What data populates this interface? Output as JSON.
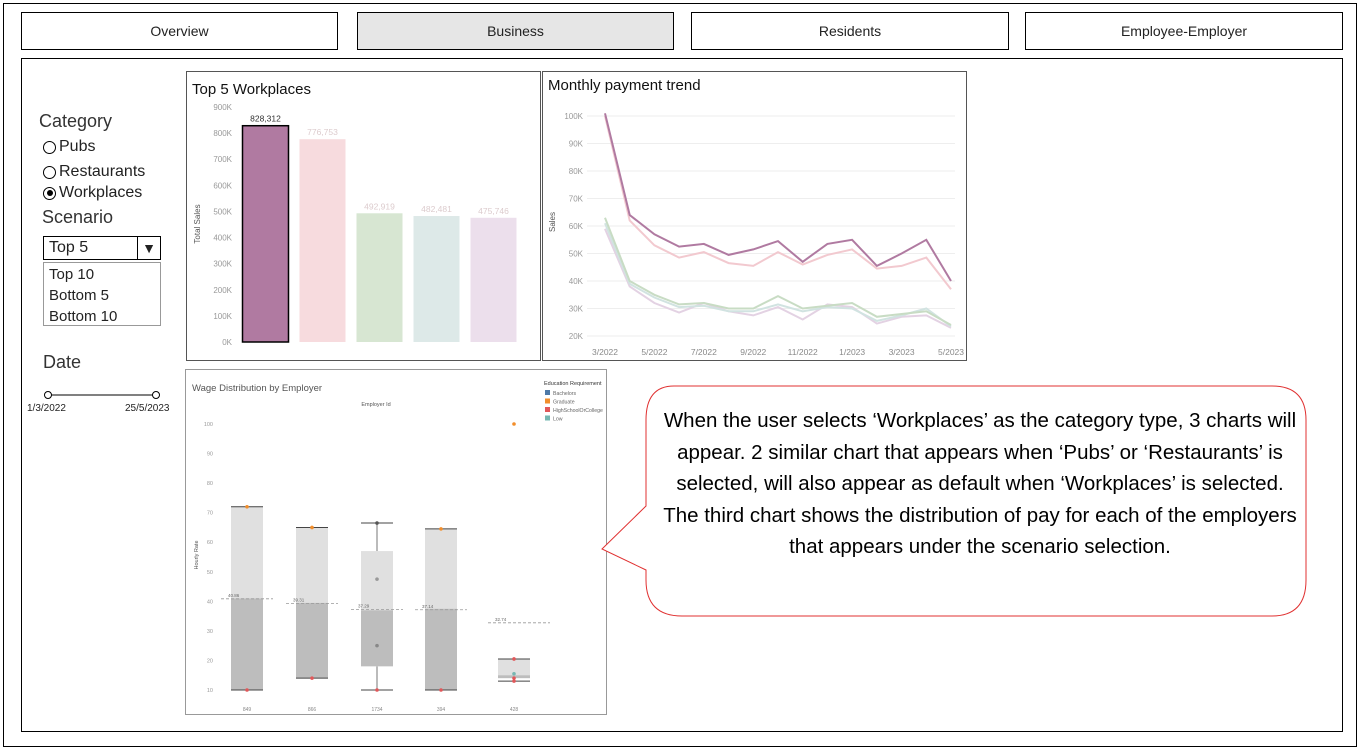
{
  "tabs": [
    {
      "label": "Overview",
      "active": false
    },
    {
      "label": "Business",
      "active": true
    },
    {
      "label": "Residents",
      "active": false
    },
    {
      "label": "Employee-Employer",
      "active": false
    }
  ],
  "filters": {
    "category_label": "Category",
    "category_options": [
      "Pubs",
      "Restaurants",
      "Workplaces"
    ],
    "category_selected": "Workplaces",
    "scenario_label": "Scenario",
    "scenario_selected": "Top 5",
    "scenario_options": [
      "Top 10",
      "Bottom 5",
      "Bottom 10"
    ],
    "date_label": "Date",
    "date_start": "1/3/2022",
    "date_end": "25/5/2023"
  },
  "charts": {
    "top5_title": "Top 5 Workplaces",
    "trend_title": "Monthly payment trend",
    "wage_title": "Wage Distribution by Employer"
  },
  "callout_text": "When the user selects ‘Workplaces’ as the category type, 3 charts will appear. 2 similar chart  that appears when ‘Pubs’ or ‘Restaurants’ is selected, will also appear as default when ‘Workplaces’ is selected. The third chart shows the distribution of pay for each of the employers that appears under the scenario selection.",
  "colors": {
    "highlight": "#b07aa1",
    "pink": "#f7dbde",
    "green": "#d7e6d2",
    "teal": "#dde9e8",
    "lavender": "#ecdfec"
  },
  "chart_data": [
    {
      "type": "bar",
      "title": "Top 5 Workplaces",
      "ylabel": "Total Sales",
      "ylim": [
        0,
        900000
      ],
      "yticks": [
        "0K",
        "100K",
        "200K",
        "300K",
        "400K",
        "500K",
        "600K",
        "700K",
        "800K",
        "900K"
      ],
      "values": [
        828312,
        776753,
        492919,
        482481,
        475746
      ],
      "labels": [
        "828,312",
        "776,753",
        "492,919",
        "482,481",
        "475,746"
      ],
      "colors": [
        "#b07aa1",
        "#f7dbde",
        "#d7e6d2",
        "#dde9e8",
        "#ecdfec"
      ]
    },
    {
      "type": "line",
      "title": "Monthly payment trend",
      "ylabel": "Sales",
      "ylim": [
        20000,
        100000
      ],
      "yticks": [
        "20K",
        "30K",
        "40K",
        "50K",
        "60K",
        "70K",
        "80K",
        "90K",
        "100K"
      ],
      "xticks": [
        "3/2022",
        "5/2022",
        "7/2022",
        "9/2022",
        "11/2022",
        "1/2023",
        "3/2023",
        "5/2023"
      ],
      "x": [
        "3/2022",
        "4/2022",
        "5/2022",
        "6/2022",
        "7/2022",
        "8/2022",
        "9/2022",
        "10/2022",
        "11/2022",
        "12/2022",
        "1/2023",
        "2/2023",
        "3/2023",
        "4/2023",
        "5/2023"
      ],
      "series": [
        {
          "color": "#b07aa1",
          "values": [
            101000,
            64000,
            57000,
            52500,
            53500,
            49500,
            51500,
            54500,
            47000,
            53500,
            55000,
            45500,
            50000,
            55000,
            40000
          ]
        },
        {
          "color": "#f2c9cf",
          "values": [
            100000,
            62000,
            53000,
            48500,
            50500,
            46500,
            45500,
            50500,
            46000,
            49500,
            51500,
            44500,
            45500,
            48500,
            37000
          ]
        },
        {
          "color": "#c8dcc4",
          "values": [
            63000,
            40000,
            35000,
            31500,
            32000,
            30000,
            30000,
            34500,
            30000,
            31000,
            32000,
            27000,
            28000,
            29000,
            24000
          ]
        },
        {
          "color": "#d1e3e1",
          "values": [
            61000,
            39000,
            34000,
            30500,
            31000,
            29000,
            29000,
            31500,
            29000,
            30500,
            30000,
            25500,
            27500,
            30000,
            23500
          ]
        },
        {
          "color": "#e3d2e3",
          "values": [
            59000,
            38000,
            32000,
            28500,
            32000,
            29000,
            27500,
            30500,
            26000,
            31500,
            30500,
            24500,
            27000,
            27500,
            23000
          ]
        }
      ]
    },
    {
      "type": "box",
      "title": "Wage Distribution by Employer",
      "xlabel": "Employer Id",
      "ylabel": "Hourly Rate",
      "ylim": [
        10,
        100
      ],
      "yticks": [
        "10",
        "20",
        "30",
        "40",
        "50",
        "60",
        "70",
        "80",
        "90",
        "100"
      ],
      "legend_title": "Education Requirement",
      "legend": [
        {
          "name": "Bachelors",
          "color": "#4e79a7"
        },
        {
          "name": "Graduate",
          "color": "#f28e2b"
        },
        {
          "name": "HighSchoolOrCollege",
          "color": "#e15759"
        },
        {
          "name": "Low",
          "color": "#76b7b2"
        }
      ],
      "categories": [
        "849",
        "866",
        "1734",
        "394",
        "428"
      ],
      "medians": [
        41,
        39.5,
        37,
        37.5,
        15
      ],
      "q1": [
        10,
        14,
        18,
        10,
        14
      ],
      "q3": [
        72,
        65,
        57,
        64.5,
        20.5
      ],
      "whisker_low": [
        10,
        14,
        10,
        10,
        13
      ],
      "whisker_high": [
        72,
        65,
        66.5,
        64.5,
        20.5
      ],
      "ref_lines": [
        40.86,
        39.31,
        37.29,
        37.14,
        32.74
      ],
      "ref_labels": [
        "40.86",
        "39.31",
        "37.29",
        "37.14",
        "32.74"
      ],
      "points": [
        {
          "cat": 0,
          "y": 72,
          "color": "#f28e2b"
        },
        {
          "cat": 0,
          "y": 10,
          "color": "#e15759"
        },
        {
          "cat": 1,
          "y": 65,
          "color": "#f28e2b"
        },
        {
          "cat": 1,
          "y": 14,
          "color": "#e15759"
        },
        {
          "cat": 2,
          "y": 66.5,
          "color": "#555555"
        },
        {
          "cat": 2,
          "y": 47.5,
          "color": "#999999"
        },
        {
          "cat": 2,
          "y": 25,
          "color": "#888888"
        },
        {
          "cat": 2,
          "y": 10,
          "color": "#e15759"
        },
        {
          "cat": 3,
          "y": 64.5,
          "color": "#f28e2b"
        },
        {
          "cat": 3,
          "y": 10,
          "color": "#e15759"
        },
        {
          "cat": 4,
          "y": 100,
          "color": "#f28e2b"
        },
        {
          "cat": 4,
          "y": 20.5,
          "color": "#e15759"
        },
        {
          "cat": 4,
          "y": 15.5,
          "color": "#76b7b2"
        },
        {
          "cat": 4,
          "y": 14,
          "color": "#e15759"
        },
        {
          "cat": 4,
          "y": 13,
          "color": "#e15759"
        }
      ]
    }
  ]
}
